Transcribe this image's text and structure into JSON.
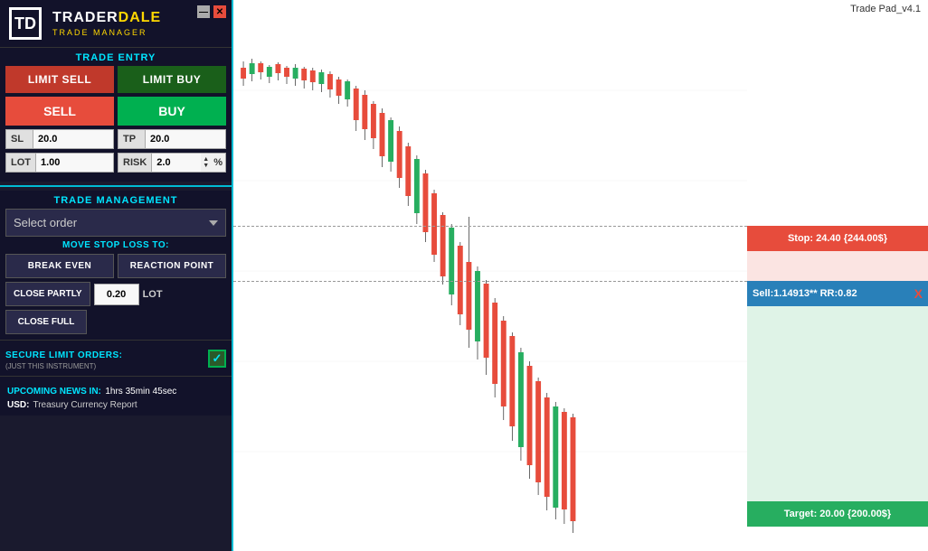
{
  "app": {
    "version": "Trade Pad_v4.1",
    "title": "Trader Dale Trade Manager"
  },
  "logo": {
    "initials": "TD",
    "trader": "TRADER",
    "dale": "DALE",
    "subtitle": "TRADE MANAGER"
  },
  "window": {
    "minimize": "—",
    "close": "✕"
  },
  "trade_entry": {
    "section_label": "TRADE ENTRY",
    "limit_sell": "LIMIT SELL",
    "limit_buy": "LIMIT BUY",
    "sell": "SELL",
    "buy": "BUY",
    "sl_label": "SL",
    "sl_value": "20.0",
    "tp_label": "TP",
    "tp_value": "20.0",
    "lot_label": "LOT",
    "lot_value": "1.00",
    "risk_label": "RISK",
    "risk_value": "2.0",
    "risk_pct": "%"
  },
  "trade_management": {
    "section_label": "TRADE MANAGEMENT",
    "select_order": "Select order",
    "move_stop_label": "MOVE STOP LOSS TO:",
    "break_even": "BREAK EVEN",
    "reaction_point": "REACTION POINT",
    "close_partly": "CLOSE PARTLY",
    "lot_value": "0.20",
    "lot_label": "LOT",
    "close_full": "CLOSE FULL"
  },
  "secure": {
    "label": "SECURE LIMIT ORDERS:",
    "sublabel": "(JUST THIS INSTRUMENT)",
    "checked": true
  },
  "news": {
    "upcoming_label": "UPCOMING NEWS IN:",
    "timer": "1hrs 35min 45sec",
    "usd_label": "USD:",
    "usd_value": "Treasury Currency Report"
  },
  "chart": {
    "stop_label": "Stop: 24.40 {244.00$}",
    "sell_label": "Sell:1.14913** RR:0.82",
    "sell_x": "X",
    "target_label": "Target: 20.00 {200.00$}",
    "stop_top_pct": 42,
    "sell_top_pct": 52,
    "target_top_pct": 91
  }
}
